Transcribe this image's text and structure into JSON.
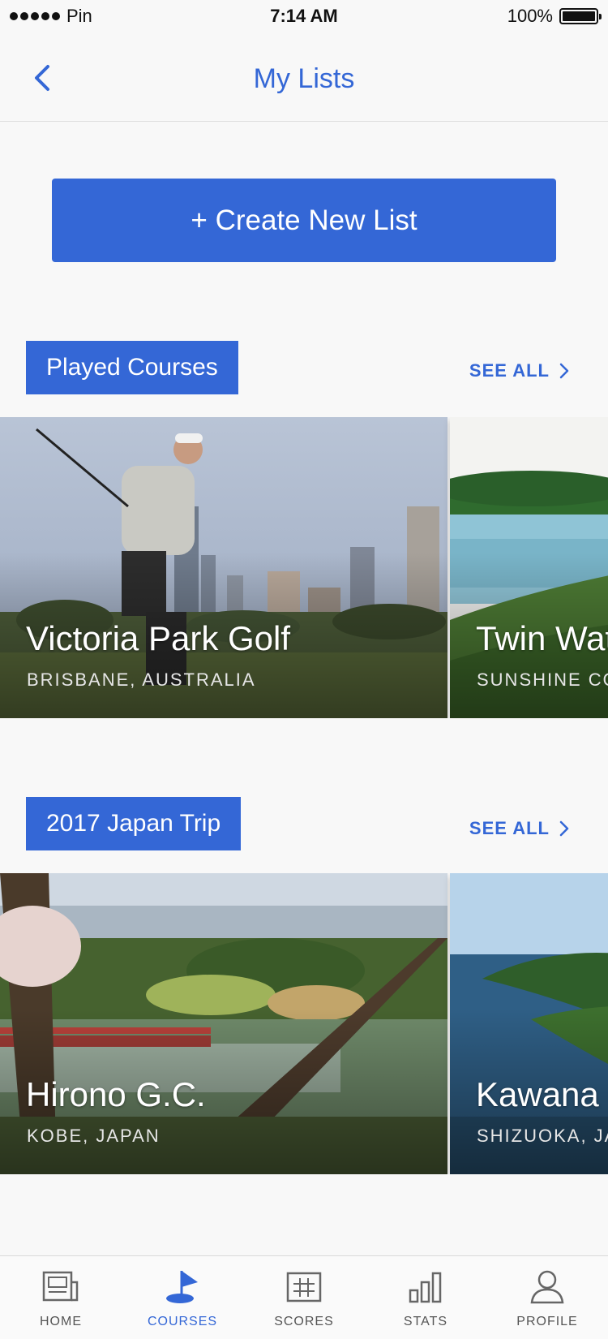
{
  "status_bar": {
    "carrier": "Pin",
    "time": "7:14 AM",
    "battery": "100%"
  },
  "nav": {
    "title": "My Lists"
  },
  "create_button": {
    "label": "+ Create New List"
  },
  "lists": [
    {
      "name": "Played Courses",
      "see_all": "SEE ALL",
      "courses": [
        {
          "name": "Victoria Park Golf",
          "location": "BRISBANE, AUSTRALIA"
        },
        {
          "name": "Twin Wat",
          "location": "SUNSHINE CO"
        }
      ]
    },
    {
      "name": "2017 Japan Trip",
      "see_all": "SEE ALL",
      "courses": [
        {
          "name": "Hirono G.C.",
          "location": "KOBE, JAPAN"
        },
        {
          "name": "Kawana (",
          "location": "SHIZUOKA, JA"
        }
      ]
    }
  ],
  "tabs": [
    {
      "label": "HOME",
      "icon": "newspaper-icon",
      "active": false
    },
    {
      "label": "COURSES",
      "icon": "flag-icon",
      "active": true
    },
    {
      "label": "SCORES",
      "icon": "scorecard-icon",
      "active": false
    },
    {
      "label": "STATS",
      "icon": "bar-chart-icon",
      "active": false
    },
    {
      "label": "PROFILE",
      "icon": "person-icon",
      "active": false
    }
  ],
  "colors": {
    "accent": "#3467d6",
    "background": "#f8f8f8"
  }
}
